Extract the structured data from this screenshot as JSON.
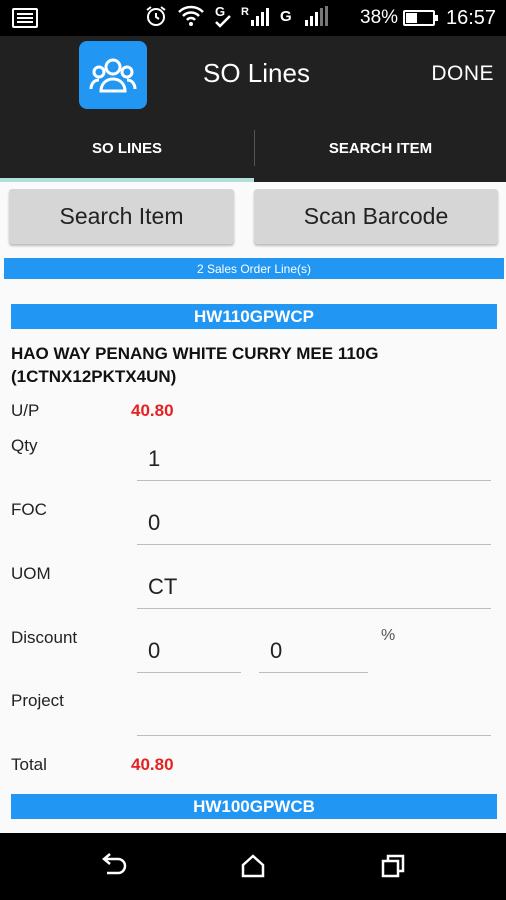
{
  "status_bar": {
    "battery_text": "38%",
    "battery_level": 0.38,
    "time": "16:57",
    "icons": [
      "notification-icon",
      "alarm-icon",
      "wifi-icon",
      "signal-icon",
      "signal-icon"
    ]
  },
  "action_bar": {
    "title": "SO Lines",
    "done_label": "DONE",
    "icon": "app-users-icon"
  },
  "tabs": [
    {
      "label": "SO LINES",
      "active": true
    },
    {
      "label": "SEARCH ITEM",
      "active": false
    }
  ],
  "buttons": {
    "search_item": "Search Item",
    "scan_barcode": "Scan Barcode"
  },
  "line_count": "2 Sales Order Line(s)",
  "lines": [
    {
      "code": "HW110GPWCP",
      "description": "HAO WAY PENANG WHITE CURRY MEE 110G (1CTNX12PKTX4UN)",
      "up_label": "U/P",
      "up_value": "40.80",
      "qty_label": "Qty",
      "qty_value": "1",
      "foc_label": "FOC",
      "foc_value": "0",
      "uom_label": "UOM",
      "uom_value": "CT",
      "discount_label": "Discount",
      "discount_1": "0",
      "discount_2": "0",
      "percent_symbol": "%",
      "project_label": "Project",
      "project_value": "",
      "total_label": "Total",
      "total_value": "40.80"
    },
    {
      "code": "HW100GPWCB"
    }
  ],
  "colors": {
    "accent": "#2196f3",
    "price": "#e52222",
    "toolbar": "#212121"
  }
}
